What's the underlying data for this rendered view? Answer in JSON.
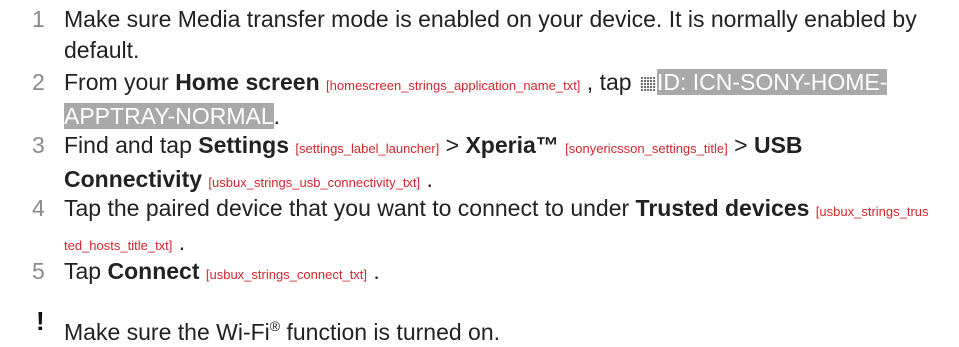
{
  "steps": [
    {
      "num": "1",
      "text": "Make sure Media transfer mode is enabled on your device. It is normally enabled by default."
    },
    {
      "num": "2",
      "pre": "From your ",
      "bold": "Home screen",
      "tag": "[homescreen_strings_application_name_txt]",
      "mid": " , tap ",
      "icon_name": "app-tray-grid-icon",
      "highlight": "ID: ICN-SONY-HOME-APPTRAY-NORMAL",
      "post": "."
    },
    {
      "num": "3",
      "pre": "Find and tap ",
      "bold1": "Settings",
      "tag1": "[settings_label_launcher]",
      "sep1": " > ",
      "bold2": "Xperia™",
      "tag2": "[sonyericsson_settings_title]",
      "sep2": " > ",
      "bold3": "USB Connectivity",
      "tag3": "[usbux_strings_usb_connectivity_txt]",
      "post": " ."
    },
    {
      "num": "4",
      "pre": "Tap the paired device that you want to connect to under ",
      "bold": "Trusted devices",
      "tag": "[usbux_strings_trusted_hosts_title_txt]",
      "post": " ."
    },
    {
      "num": "5",
      "pre": "Tap ",
      "bold": "Connect",
      "tag": "[usbux_strings_connect_txt]",
      "post": " ."
    }
  ],
  "note": {
    "icon": "!",
    "icon_name": "exclamation-icon",
    "text_pre": "Make sure the Wi-Fi",
    "sup": "®",
    "text_post": " function is turned on."
  },
  "colors": {
    "tag": "#d4272e",
    "highlight_bg": "#a9a9a9",
    "number": "#8a8a8a"
  }
}
